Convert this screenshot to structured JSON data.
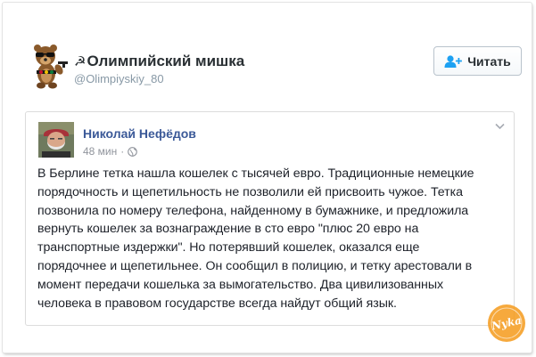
{
  "header": {
    "hammer_sickle": "☭",
    "display_name": "Олимпийский мишка",
    "handle": "@Olimpiyskiy_80",
    "follow_label": "Читать"
  },
  "post": {
    "author": "Николай Нефёдов",
    "time": "48 мин",
    "separator": "·",
    "privacy_icon": "globe-icon",
    "menu_icon": "chevron-down-icon",
    "text": "В Берлине тетка нашла кошелек с тысячей евро. Традиционные немецкие\nпорядочность и щепетильность не позволили ей присвоить чужое. Тетка\nпозвонила по номеру телефона, найденному в бумажнике, и предложила\nвернуть кошелек за вознаграждение в сто евро \"плюс 20 евро на\nтранспортные издержки\". Но потерявший кошелек, оказался еще\nпорядочнее и щепетильнее. Он сообщил в полицию, и тетку арестовали в\nмомент передачи кошелька за вымогательство. Два цивилизованных\nчеловека в правовом государстве всегда найдут общий язык."
  },
  "watermark": {
    "text": "Nyka"
  },
  "colors": {
    "follow_icon": "#1da1f2",
    "author_link": "#3b5998",
    "meta_gray": "#90949c",
    "watermark_orange": "#f59a1b"
  }
}
